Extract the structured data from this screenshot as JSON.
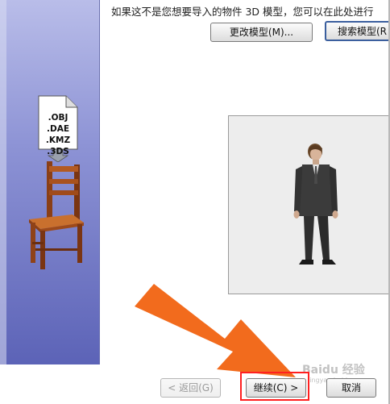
{
  "banner": {
    "file_types": [
      ".OBJ",
      ".DAE",
      ".KMZ",
      ".3DS"
    ]
  },
  "main": {
    "prompt_text": "如果这不是您想要导入的物件 3D 模型，您可以在此处进行",
    "change_model_label": "更改模型(M)...",
    "search_model_label": "搜索模型(R"
  },
  "footer": {
    "back_label": "< 返回(G)",
    "next_label": "继续(C) >",
    "cancel_label": "取消"
  },
  "watermark": {
    "text": "Baidu 经验",
    "sub": "jingyan.baidu.com"
  },
  "colors": {
    "banner_top": "#b9bde9",
    "banner_bottom": "#5c63b7",
    "arrow": "#f26b1d",
    "highlight": "#ff2020"
  }
}
